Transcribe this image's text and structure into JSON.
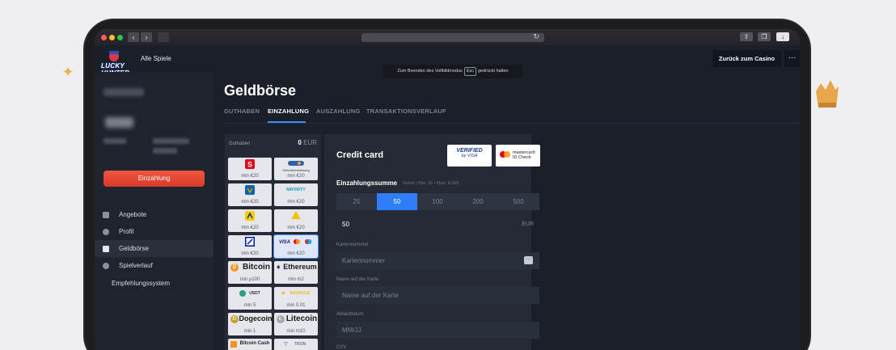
{
  "browser": {
    "reload_icon": "reload-icon"
  },
  "header": {
    "logo_text": "LUCKY HUNTER",
    "all_games": "Alle Spiele",
    "back_label": "Zurück zum Casino",
    "more_label": "···"
  },
  "fullscreen_note": {
    "before": "Zum Beenden des Vollbildmodus",
    "key": "Esc",
    "after": "gedrückt halten"
  },
  "sidebar": {
    "deposit_label": "Einzahlung",
    "items": [
      {
        "label": "Angebote",
        "icon": "offers-icon"
      },
      {
        "label": "Profil",
        "icon": "profile-icon"
      },
      {
        "label": "Geldbörse",
        "icon": "wallet-icon"
      },
      {
        "label": "Spielverlauf",
        "icon": "history-icon"
      },
      {
        "label": "Empfehlungssystem",
        "icon": ""
      }
    ]
  },
  "wallet": {
    "title": "Geldbörse",
    "tabs": [
      "GUTHABEN",
      "EINZAHLUNG",
      "AUSZAHLUNG",
      "TRANSAKTIONSVERLAUF"
    ],
    "active_tab": "EINZAHLUNG",
    "balance_label": "Guthaben",
    "balance_value": "0",
    "balance_currency": "EUR"
  },
  "methods": [
    {
      "name": "Sparkasse",
      "min": "min €20"
    },
    {
      "name": "Sofortüberweisung",
      "min": "min €20"
    },
    {
      "name": "Volksbank",
      "min": "min €20"
    },
    {
      "name": "MIFINITY",
      "min": "min €20"
    },
    {
      "name": "Postbank",
      "min": "min €20"
    },
    {
      "name": "Commerzbank",
      "min": "min €20"
    },
    {
      "name": "Deutsche Bank",
      "min": "min €20"
    },
    {
      "name": "VISA",
      "min": "min €20"
    },
    {
      "name": "Bitcoin",
      "min": "min µ100"
    },
    {
      "name": "Ethereum",
      "min": "min m2"
    },
    {
      "name": "USDT",
      "min": "min 5"
    },
    {
      "name": "BINANCE",
      "min": "min 0.01"
    },
    {
      "name": "Dogecoin",
      "min": "min 1"
    },
    {
      "name": "Litecoin",
      "min": "min m10"
    },
    {
      "name": "Bitcoin Cash",
      "min": ""
    },
    {
      "name": "TRON",
      "min": ""
    }
  ],
  "credit_card": {
    "title": "Credit card",
    "vbv_line1": "VERIFIED",
    "vbv_line2": "by VISA",
    "mc_line1": "mastercard",
    "mc_line2": "ID Check",
    "amount_title": "Einzahlungssumme",
    "amount_sub": "Sofort | Min: 20 • Max: 4,000",
    "amounts": [
      "25",
      "50",
      "100",
      "200",
      "500"
    ],
    "selected_amount": "50",
    "amount_value": "50",
    "amount_currency": "EUR",
    "card_number_label": "Kartennummer",
    "card_number_placeholder": "Kartennummer",
    "name_label": "Name auf der Karte",
    "name_placeholder": "Name auf der Karte",
    "expiry_label": "Ablaufdatum",
    "expiry_placeholder": "MM/JJ",
    "cvv_label": "CVV"
  },
  "colors": {
    "accent": "#2d7ef8",
    "deposit": "#e8452f",
    "background": "#1b1f2a"
  }
}
